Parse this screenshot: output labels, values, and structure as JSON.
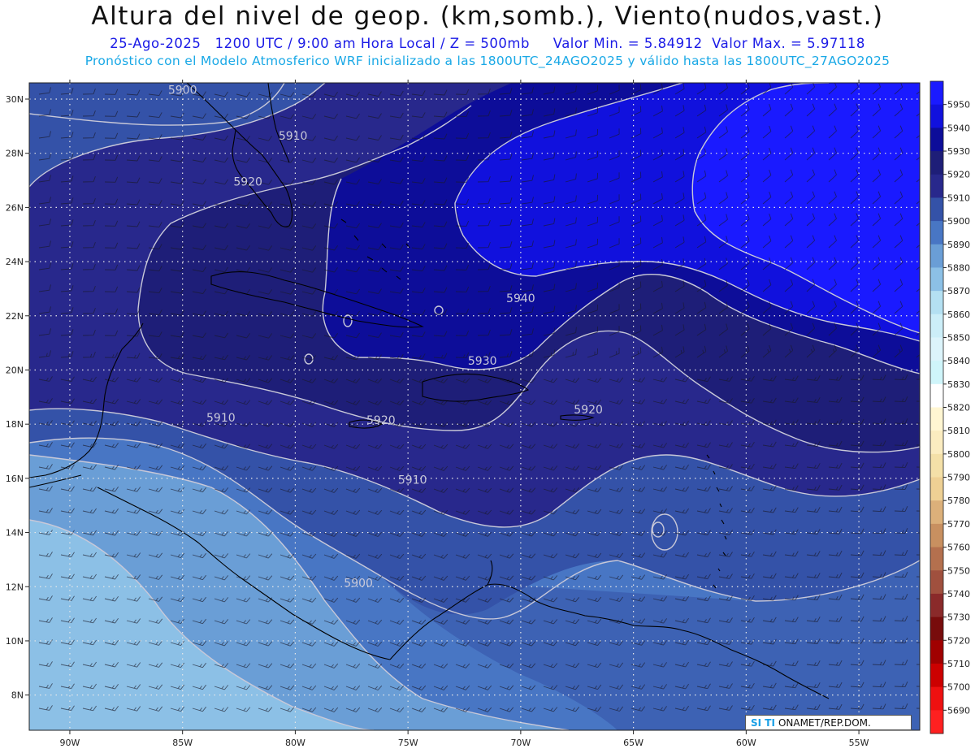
{
  "title": "Altura del nivel de geop. (km,somb.), Viento(nudos,vast.)",
  "date": "25-Ago-2025",
  "time_info": "1200 UTC / 9:00 am Hora Local / Z = 500mb",
  "min_label": "Valor Min. = 5.84912",
  "max_label": "Valor Max. = 5.97118",
  "forecast_line": "Pronóstico con el Modelo Atmosferico WRF inicializado a las 1800UTC_24AGO2025 y válido hasta las  1800UTC_27AGO2025",
  "credit": {
    "tag": "SI TI",
    "text": "ONAMET/REP.DOM."
  },
  "lon_ticks": [
    {
      "value": -90,
      "label": "90W"
    },
    {
      "value": -85,
      "label": "85W"
    },
    {
      "value": -80,
      "label": "80W"
    },
    {
      "value": -75,
      "label": "75W"
    },
    {
      "value": -70,
      "label": "70W"
    },
    {
      "value": -65,
      "label": "65W"
    },
    {
      "value": -60,
      "label": "60W"
    },
    {
      "value": -55,
      "label": "55W"
    }
  ],
  "lat_ticks": [
    {
      "value": 8,
      "label": "8N"
    },
    {
      "value": 10,
      "label": "10N"
    },
    {
      "value": 12,
      "label": "12N"
    },
    {
      "value": 14,
      "label": "14N"
    },
    {
      "value": 16,
      "label": "16N"
    },
    {
      "value": 18,
      "label": "18N"
    },
    {
      "value": 20,
      "label": "20N"
    },
    {
      "value": 22,
      "label": "22N"
    },
    {
      "value": 24,
      "label": "24N"
    },
    {
      "value": 26,
      "label": "26N"
    },
    {
      "value": 28,
      "label": "28N"
    },
    {
      "value": 30,
      "label": "30N"
    }
  ],
  "extent": {
    "lon": [
      -91.8,
      -52.3
    ],
    "lat": [
      6.7,
      30.6
    ]
  },
  "contour_labels": [
    {
      "text": "5900",
      "lon": -85.0,
      "lat": 30.2
    },
    {
      "text": "5910",
      "lon": -80.1,
      "lat": 28.5
    },
    {
      "text": "5920",
      "lon": -82.1,
      "lat": 26.8
    },
    {
      "text": "5940",
      "lon": -70.0,
      "lat": 22.5
    },
    {
      "text": "5930",
      "lon": -71.7,
      "lat": 20.2
    },
    {
      "text": "5920",
      "lon": -76.2,
      "lat": 18.0
    },
    {
      "text": "5920",
      "lon": -67.0,
      "lat": 18.4
    },
    {
      "text": "5910",
      "lon": -83.3,
      "lat": 18.1
    },
    {
      "text": "5910",
      "lon": -74.8,
      "lat": 15.8
    },
    {
      "text": "5900",
      "lon": -77.2,
      "lat": 12.0
    }
  ],
  "colorbar": [
    {
      "value": 5950,
      "label": "5950",
      "color": "#1a1aff"
    },
    {
      "value": 5940,
      "label": "5940",
      "color": "#1111dd"
    },
    {
      "value": 5930,
      "label": "5930",
      "color": "#0d0d99"
    },
    {
      "value": 5920,
      "label": "5920",
      "color": "#1e1e78"
    },
    {
      "value": 5910,
      "label": "5910",
      "color": "#28288c"
    },
    {
      "value": 5900,
      "label": "5900",
      "color": "#3452a8"
    },
    {
      "value": 5890,
      "label": "5890",
      "color": "#4876c4"
    },
    {
      "value": 5880,
      "label": "5880",
      "color": "#6a9ed6"
    },
    {
      "value": 5870,
      "label": "5870",
      "color": "#8cc0e6"
    },
    {
      "value": 5860,
      "label": "5860",
      "color": "#b4e0f2"
    },
    {
      "value": 5850,
      "label": "5850",
      "color": "#cceef8"
    },
    {
      "value": 5840,
      "label": "5840",
      "color": "#dcf4fb"
    },
    {
      "value": 5830,
      "label": "5830",
      "color": "#cff5fa"
    },
    {
      "value": 5820,
      "label": "5820",
      "color": "#ffffff"
    },
    {
      "value": 5810,
      "label": "5810",
      "color": "#fff6d2"
    },
    {
      "value": 5800,
      "label": "5800",
      "color": "#fbecc0"
    },
    {
      "value": 5790,
      "label": "5790",
      "color": "#f4e0a8"
    },
    {
      "value": 5780,
      "label": "5780",
      "color": "#eed094"
    },
    {
      "value": 5770,
      "label": "5770",
      "color": "#dcb07a"
    },
    {
      "value": 5760,
      "label": "5760",
      "color": "#c89060"
    },
    {
      "value": 5750,
      "label": "5750",
      "color": "#b4704e"
    },
    {
      "value": 5740,
      "label": "5740",
      "color": "#a0503e"
    },
    {
      "value": 5730,
      "label": "5730",
      "color": "#8a2a2a"
    },
    {
      "value": 5720,
      "label": "5720",
      "color": "#780c0c"
    },
    {
      "value": 5710,
      "label": "5710",
      "color": "#a00000"
    },
    {
      "value": 5700,
      "label": "5700",
      "color": "#cc0000"
    },
    {
      "value": 5690,
      "label": "5690",
      "color": "#ee1010"
    },
    {
      "value": 5680,
      "label": "",
      "color": "#ff2020"
    }
  ],
  "colors": {
    "ocean_low": "#8cc0e6",
    "mid": "#3452a8",
    "high": "#1a1aff",
    "contour_line": "#c8c8d8",
    "grid": "#e8e8e8",
    "coast": "#000000"
  }
}
